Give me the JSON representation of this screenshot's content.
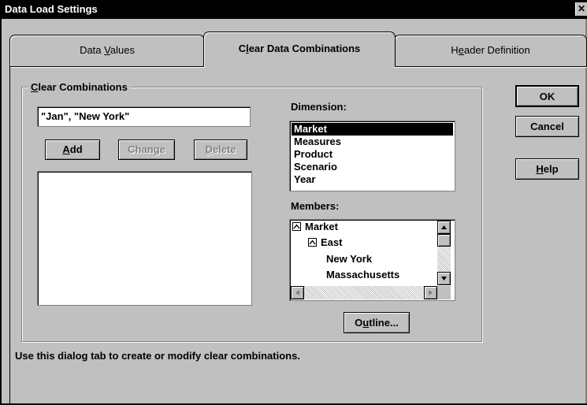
{
  "window": {
    "title": "Data Load Settings",
    "close": "✕"
  },
  "tabs": [
    {
      "pre": "Data ",
      "mnemonic": "V",
      "post": "alues"
    },
    {
      "pre": "C",
      "mnemonic": "l",
      "post": "ear Data Combinations"
    },
    {
      "pre": "H",
      "mnemonic": "e",
      "post": "ader Definition"
    }
  ],
  "group": {
    "mnemonic": "C",
    "rest": "lear Combinations"
  },
  "combination_input": {
    "value": "\"Jan\", \"New York\""
  },
  "buttons": {
    "add": {
      "mnemonic": "A",
      "rest": "dd"
    },
    "change": {
      "label": "Change"
    },
    "delete": {
      "mnemonic": "D",
      "rest": "elete"
    },
    "ok": {
      "label": "OK"
    },
    "cancel": {
      "label": "Cancel"
    },
    "help": {
      "mnemonic": "H",
      "rest": "elp"
    },
    "outline": {
      "pre": "O",
      "mnemonic": "u",
      "post": "tline..."
    }
  },
  "dimension": {
    "label": "Dimension:",
    "items": [
      "Market",
      "Measures",
      "Product",
      "Scenario",
      "Year"
    ],
    "selected": "Market"
  },
  "members": {
    "label": "Members:",
    "items": [
      "Market",
      "East",
      "New York",
      "Massachusetts"
    ]
  },
  "status_text": "Use this dialog tab to create or modify clear combinations."
}
